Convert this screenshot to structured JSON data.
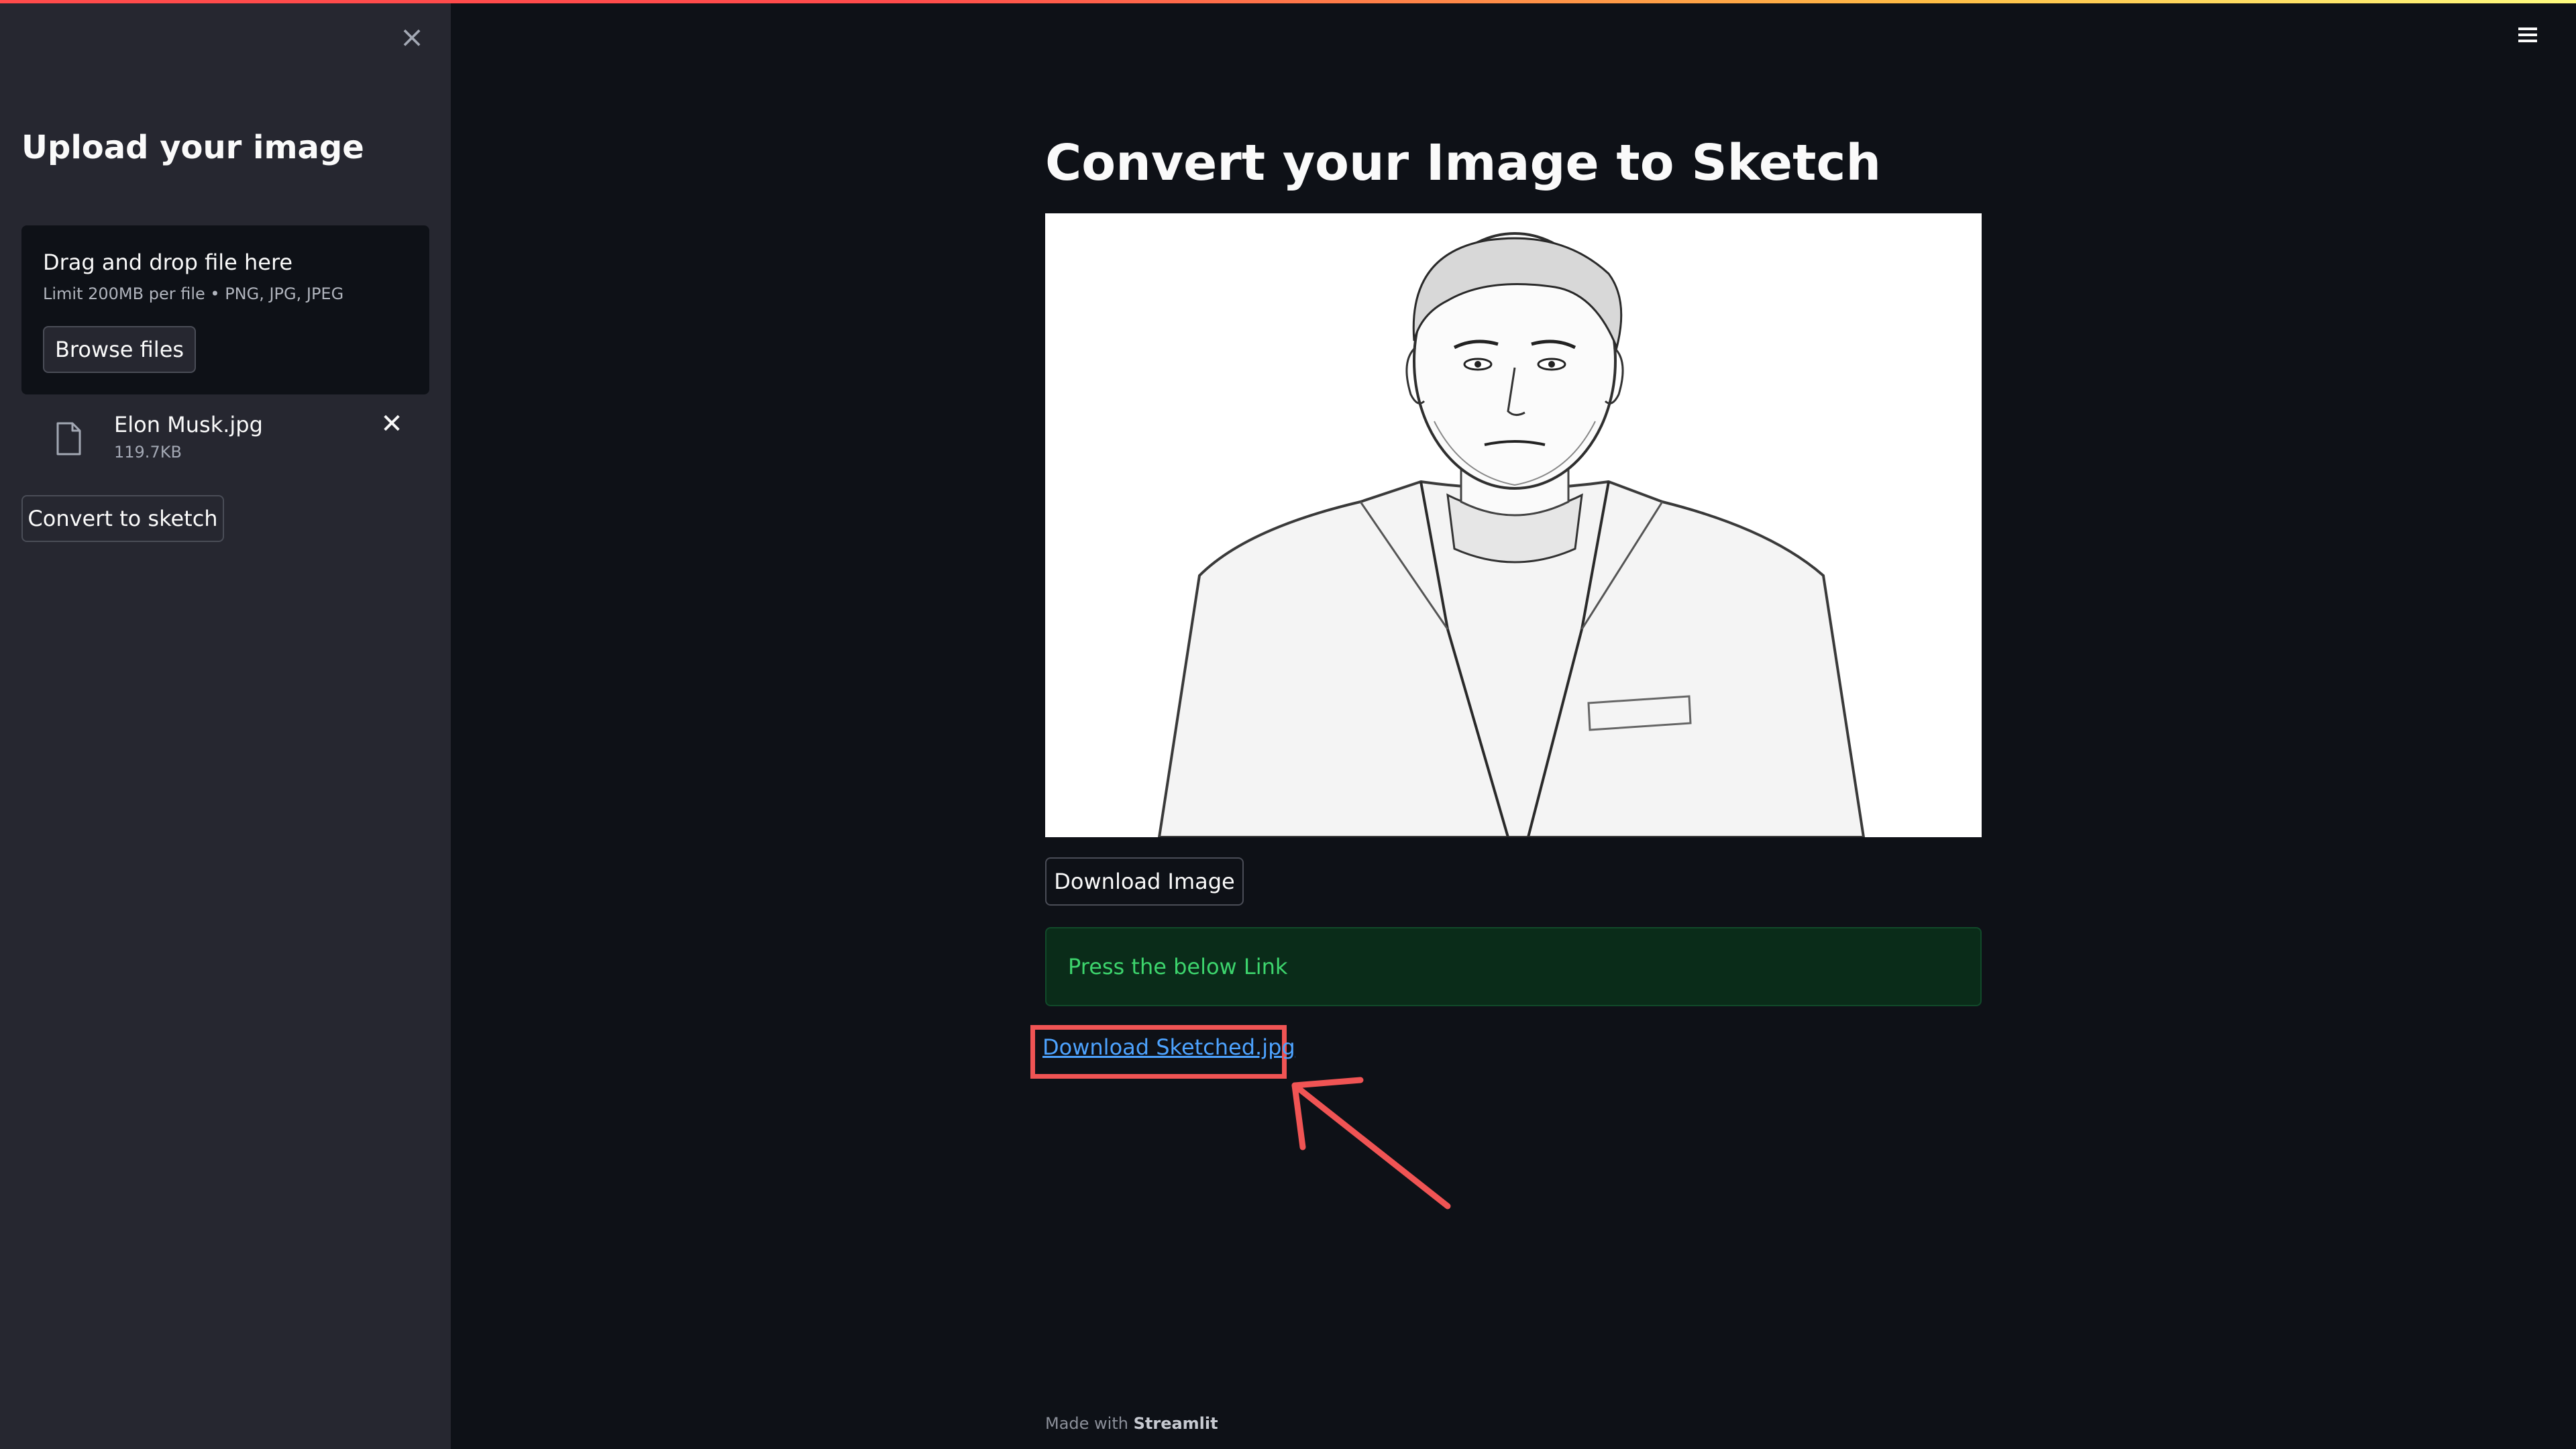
{
  "sidebar": {
    "title": "Upload your image",
    "uploader": {
      "drop_title": "Drag and drop file here",
      "limit_text": "Limit 200MB per file • PNG, JPG, JPEG",
      "browse_label": "Browse files"
    },
    "file": {
      "name": "Elon Musk.jpg",
      "size": "119.7KB"
    },
    "convert_label": "Convert to sketch"
  },
  "main": {
    "title": "Convert your Image to Sketch",
    "download_button_label": "Download Image",
    "success_text": "Press the below Link",
    "download_link_text": "Download Sketched.jpg"
  },
  "footer": {
    "prefix": "Made with",
    "brand": "Streamlit"
  },
  "colors": {
    "background": "#0e1117",
    "sidebar": "#262730",
    "success_bg": "#0a2c19",
    "success_text": "#3dd56d",
    "link": "#4da3ff",
    "highlight": "#f05454"
  }
}
